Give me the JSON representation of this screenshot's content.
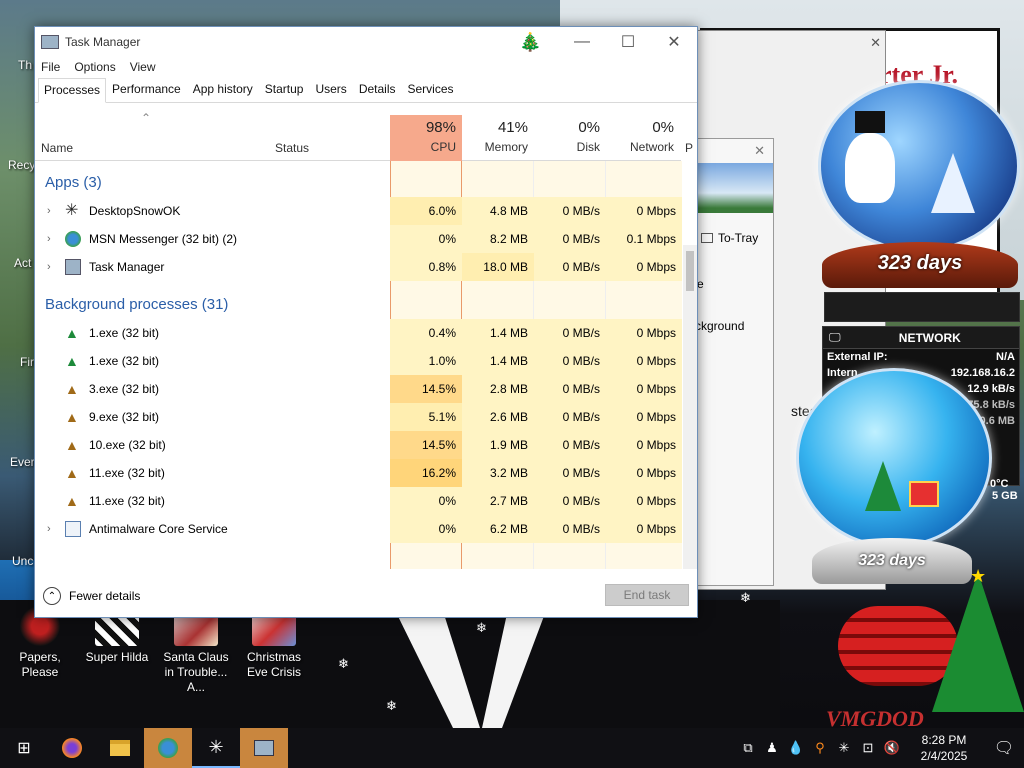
{
  "window": {
    "title": "Task Manager",
    "minimize": "—",
    "maximize": "☐",
    "close": "✕"
  },
  "menu": [
    "File",
    "Options",
    "View"
  ],
  "tabs": [
    "Processes",
    "Performance",
    "App history",
    "Startup",
    "Users",
    "Details",
    "Services"
  ],
  "columns": {
    "name": "Name",
    "status": "Status",
    "cpu": {
      "pct": "98%",
      "label": "CPU"
    },
    "memory": {
      "pct": "41%",
      "label": "Memory"
    },
    "disk": {
      "pct": "0%",
      "label": "Disk"
    },
    "network": {
      "pct": "0%",
      "label": "Network"
    },
    "power": "P"
  },
  "groups": {
    "apps": "Apps (3)",
    "background": "Background processes (31)"
  },
  "apps": [
    {
      "name": "DesktopSnowOK",
      "cpu": "6.0%",
      "memory": "4.8 MB",
      "disk": "0 MB/s",
      "network": "0 Mbps",
      "icon": "snowflake-icon"
    },
    {
      "name": "MSN Messenger (32 bit) (2)",
      "cpu": "0%",
      "memory": "8.2 MB",
      "disk": "0 MB/s",
      "network": "0.1 Mbps",
      "icon": "messenger-icon"
    },
    {
      "name": "Task Manager",
      "cpu": "0.8%",
      "memory": "18.0 MB",
      "disk": "0 MB/s",
      "network": "0 Mbps",
      "icon": "taskmanager-icon"
    }
  ],
  "background": [
    {
      "name": "1.exe (32 bit)",
      "cpu": "0.4%",
      "memory": "1.4 MB",
      "disk": "0 MB/s",
      "network": "0 Mbps"
    },
    {
      "name": "1.exe (32 bit)",
      "cpu": "1.0%",
      "memory": "1.4 MB",
      "disk": "0 MB/s",
      "network": "0 Mbps"
    },
    {
      "name": "3.exe (32 bit)",
      "cpu": "14.5%",
      "memory": "2.8 MB",
      "disk": "0 MB/s",
      "network": "0 Mbps"
    },
    {
      "name": "9.exe (32 bit)",
      "cpu": "5.1%",
      "memory": "2.6 MB",
      "disk": "0 MB/s",
      "network": "0 Mbps"
    },
    {
      "name": "10.exe (32 bit)",
      "cpu": "14.5%",
      "memory": "1.9 MB",
      "disk": "0 MB/s",
      "network": "0 Mbps"
    },
    {
      "name": "11.exe (32 bit)",
      "cpu": "16.2%",
      "memory": "3.2 MB",
      "disk": "0 MB/s",
      "network": "0 Mbps"
    },
    {
      "name": "11.exe (32 bit)",
      "cpu": "0%",
      "memory": "2.7 MB",
      "disk": "0 MB/s",
      "network": "0 Mbps"
    },
    {
      "name": "Antimalware Core Service",
      "cpu": "0%",
      "memory": "6.2 MB",
      "disk": "0 MB/s",
      "network": "0 Mbps"
    }
  ],
  "footer": {
    "fewer_details": "Fewer details",
    "end_task": "End task"
  },
  "back_window": {
    "to_tray": "To-Tray",
    "text_e": "e",
    "text_background": "ckground",
    "text_instead": "stead",
    "sign": "rter Jr."
  },
  "desktop_icons": [
    {
      "label": "Papers, Please"
    },
    {
      "label": "Super Hilda"
    },
    {
      "label": "Santa Claus in Trouble... A..."
    },
    {
      "label": "Christmas Eve Crisis"
    }
  ],
  "left_edge": [
    "Th",
    "Recy",
    "Act",
    "Fir",
    "Ever",
    "Unc"
  ],
  "gadgets": {
    "days_top": "323 days",
    "days_bottom": "323 days",
    "network": {
      "title": "NETWORK",
      "external_ip_label": "External IP:",
      "external_ip": "N/A",
      "internal_label": "Intern",
      "internal_ip": "192.168.16.2",
      "up": "12.9 kB/s",
      "down": "75.8 kB/s",
      "total": "30.6 MB",
      "temp": "0°C",
      "size": "5 GB"
    },
    "brand": "VMGDOD"
  },
  "clock": {
    "time": "8:28 PM",
    "date": "2/4/2025"
  },
  "colors": {
    "cpu_header": "#f6a98c",
    "heat_light": "#fff4c4",
    "heat_mid": "#ffe69a",
    "heat_high": "#ffd57a",
    "group": "#2a5ea8"
  }
}
